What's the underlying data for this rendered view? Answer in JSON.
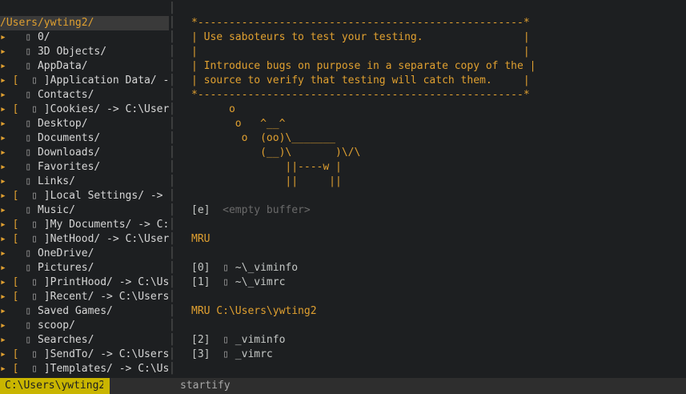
{
  "tree": {
    "header": "/Users/ywting2/",
    "items": [
      {
        "prefix": "▸   ",
        "icon": "▯",
        "text": " 0/"
      },
      {
        "prefix": "▸   ",
        "icon": "▯",
        "text": " 3D Objects/"
      },
      {
        "prefix": "▸   ",
        "icon": "▯",
        "text": " AppData/"
      },
      {
        "prefix": "▸ [  ",
        "icon": "▯",
        "text": " ]Application Data/ -> C"
      },
      {
        "prefix": "▸   ",
        "icon": "▯",
        "text": " Contacts/"
      },
      {
        "prefix": "▸ [  ",
        "icon": "▯",
        "text": " ]Cookies/ -> C:\\Users\\y"
      },
      {
        "prefix": "▸   ",
        "icon": "▯",
        "text": " Desktop/"
      },
      {
        "prefix": "▸   ",
        "icon": "▯",
        "text": " Documents/"
      },
      {
        "prefix": "▸   ",
        "icon": "▯",
        "text": " Downloads/"
      },
      {
        "prefix": "▸   ",
        "icon": "▯",
        "text": " Favorites/"
      },
      {
        "prefix": "▸   ",
        "icon": "▯",
        "text": " Links/"
      },
      {
        "prefix": "▸ [  ",
        "icon": "▯",
        "text": " ]Local Settings/ -> C:\\"
      },
      {
        "prefix": "▸   ",
        "icon": "▯",
        "text": " Music/"
      },
      {
        "prefix": "▸ [  ",
        "icon": "▯",
        "text": " ]My Documents/ -> C:\\Us"
      },
      {
        "prefix": "▸ [  ",
        "icon": "▯",
        "text": " ]NetHood/ -> C:\\Users\\y"
      },
      {
        "prefix": "▸   ",
        "icon": "▯",
        "text": " OneDrive/"
      },
      {
        "prefix": "▸   ",
        "icon": "▯",
        "text": " Pictures/"
      },
      {
        "prefix": "▸ [  ",
        "icon": "▯",
        "text": " ]PrintHood/ -> C:\\Users"
      },
      {
        "prefix": "▸ [  ",
        "icon": "▯",
        "text": " ]Recent/ -> C:\\Users\\yw"
      },
      {
        "prefix": "▸   ",
        "icon": "▯",
        "text": " Saved Games/"
      },
      {
        "prefix": "▸   ",
        "icon": "▯",
        "text": " scoop/"
      },
      {
        "prefix": "▸   ",
        "icon": "▯",
        "text": " Searches/"
      },
      {
        "prefix": "▸ [  ",
        "icon": "▯",
        "text": " ]SendTo/ -> C:\\Users\\yw"
      },
      {
        "prefix": "▸ [  ",
        "icon": "▯",
        "text": " ]Templates/ -> C:\\Users"
      }
    ]
  },
  "startify": {
    "box": [
      "*----------------------------------------------------*",
      "| Use saboteurs to test your testing.                |",
      "|                                                    |",
      "| Introduce bugs on purpose in a separate copy of the |",
      "| source to verify that testing will catch them.     |",
      "*----------------------------------------------------*"
    ],
    "cow": [
      "      o",
      "       o   ^__^",
      "        o  (oo)\\_______",
      "           (__)\\       )\\/\\",
      "               ||----w |",
      "               ||     ||"
    ],
    "empty_key": "[e]",
    "empty_label": "<empty buffer>",
    "mru_title": "MRU",
    "mru_items": [
      {
        "key": "[0]",
        "icon": "▯",
        "path": " ~\\_viminfo"
      },
      {
        "key": "[1]",
        "icon": "▯",
        "path": " ~\\_vimrc"
      }
    ],
    "mru_dir_title": "MRU C:\\Users\\ywting2",
    "mru_dir_items": [
      {
        "key": "[2]",
        "icon": "▯",
        "path": " _viminfo"
      },
      {
        "key": "[3]",
        "icon": "▯",
        "path": " _vimrc"
      }
    ]
  },
  "statusline": {
    "left": "C:\\Users\\ywting2",
    "right": "startify"
  }
}
